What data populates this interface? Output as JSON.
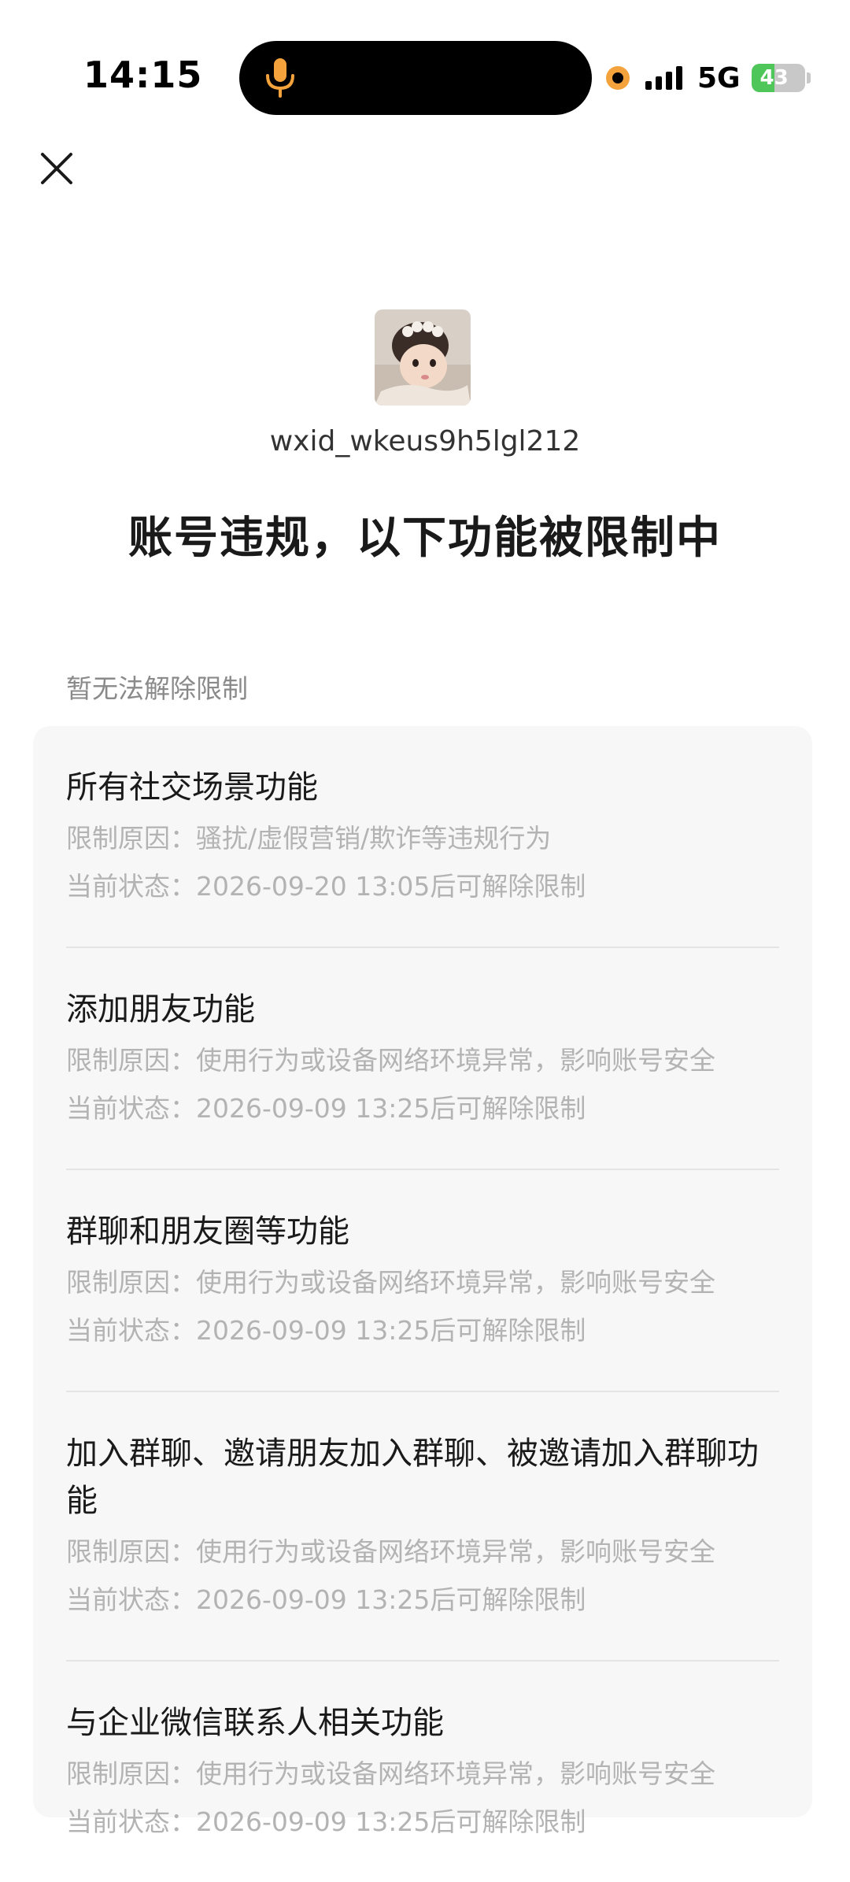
{
  "status_bar": {
    "time": "14:15",
    "network": "5G",
    "battery_level": "43",
    "battery_percent": 43,
    "accent_orange": "#f3a23c",
    "battery_green": "#4fc65a"
  },
  "header": {
    "user_id": "wxid_wkeus9h5lgl212",
    "title": "账号违规，以下功能被限制中"
  },
  "section": {
    "label": "暂无法解除限制"
  },
  "restrictions": [
    {
      "title": "所有社交场景功能",
      "reason": "限制原因：骚扰/虚假营销/欺诈等违规行为",
      "status": "当前状态：2026-09-20 13:05后可解除限制"
    },
    {
      "title": "添加朋友功能",
      "reason": "限制原因：使用行为或设备网络环境异常，影响账号安全",
      "status": "当前状态：2026-09-09 13:25后可解除限制"
    },
    {
      "title": "群聊和朋友圈等功能",
      "reason": "限制原因：使用行为或设备网络环境异常，影响账号安全",
      "status": "当前状态：2026-09-09 13:25后可解除限制"
    },
    {
      "title": "加入群聊、邀请朋友加入群聊、被邀请加入群聊功能",
      "reason": "限制原因：使用行为或设备网络环境异常，影响账号安全",
      "status": "当前状态：2026-09-09 13:25后可解除限制"
    },
    {
      "title": "与企业微信联系人相关功能",
      "reason": "限制原因：使用行为或设备网络环境异常，影响账号安全",
      "status": "当前状态：2026-09-09 13:25后可解除限制"
    }
  ],
  "icons": {
    "close": "close-icon",
    "mic": "microphone-icon",
    "signal": "cellular-signal-icon",
    "battery": "battery-icon",
    "recording": "recording-dot-icon"
  }
}
